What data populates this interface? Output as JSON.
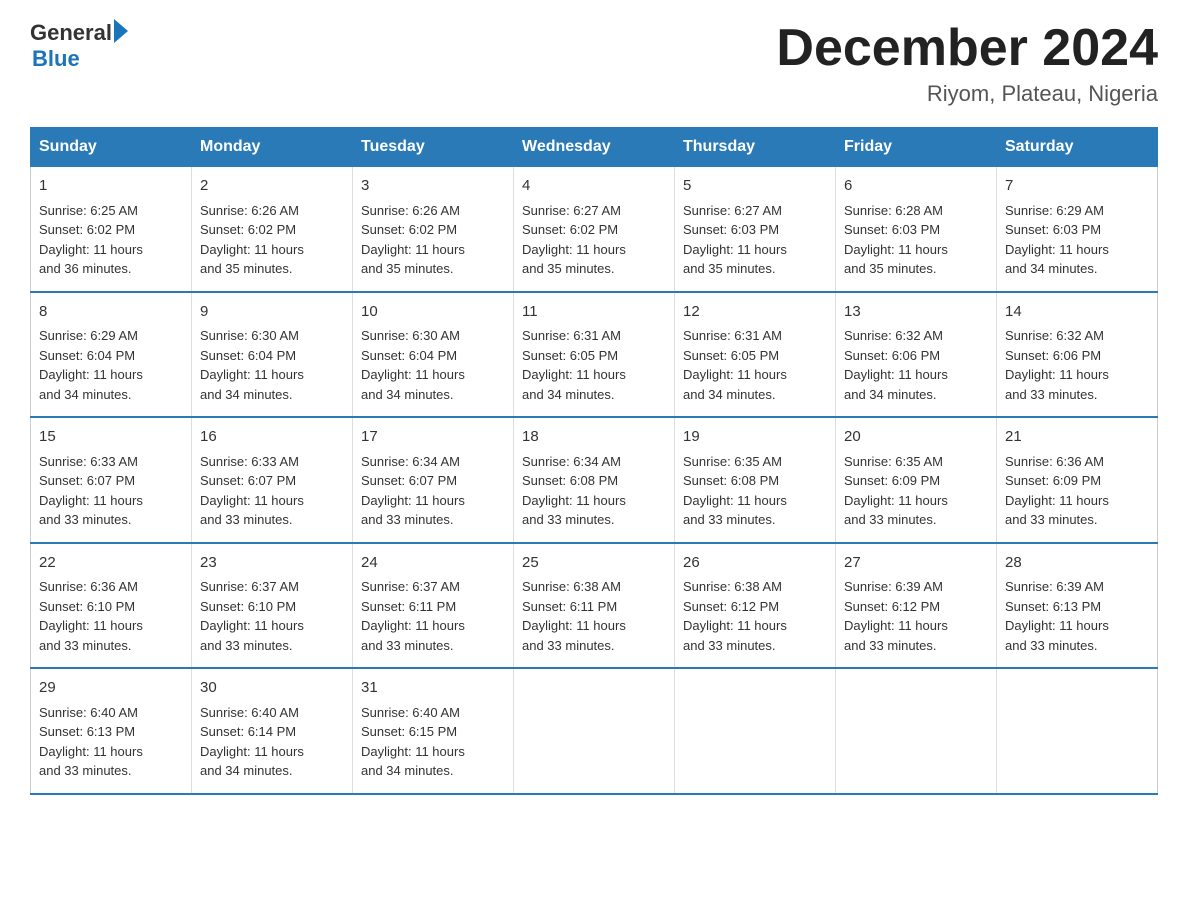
{
  "header": {
    "logo_general": "General",
    "logo_blue": "Blue",
    "month_title": "December 2024",
    "location": "Riyom, Plateau, Nigeria"
  },
  "days_of_week": [
    "Sunday",
    "Monday",
    "Tuesday",
    "Wednesday",
    "Thursday",
    "Friday",
    "Saturday"
  ],
  "weeks": [
    [
      {
        "day": "1",
        "sunrise": "6:25 AM",
        "sunset": "6:02 PM",
        "daylight": "11 hours and 36 minutes."
      },
      {
        "day": "2",
        "sunrise": "6:26 AM",
        "sunset": "6:02 PM",
        "daylight": "11 hours and 35 minutes."
      },
      {
        "day": "3",
        "sunrise": "6:26 AM",
        "sunset": "6:02 PM",
        "daylight": "11 hours and 35 minutes."
      },
      {
        "day": "4",
        "sunrise": "6:27 AM",
        "sunset": "6:02 PM",
        "daylight": "11 hours and 35 minutes."
      },
      {
        "day": "5",
        "sunrise": "6:27 AM",
        "sunset": "6:03 PM",
        "daylight": "11 hours and 35 minutes."
      },
      {
        "day": "6",
        "sunrise": "6:28 AM",
        "sunset": "6:03 PM",
        "daylight": "11 hours and 35 minutes."
      },
      {
        "day": "7",
        "sunrise": "6:29 AM",
        "sunset": "6:03 PM",
        "daylight": "11 hours and 34 minutes."
      }
    ],
    [
      {
        "day": "8",
        "sunrise": "6:29 AM",
        "sunset": "6:04 PM",
        "daylight": "11 hours and 34 minutes."
      },
      {
        "day": "9",
        "sunrise": "6:30 AM",
        "sunset": "6:04 PM",
        "daylight": "11 hours and 34 minutes."
      },
      {
        "day": "10",
        "sunrise": "6:30 AM",
        "sunset": "6:04 PM",
        "daylight": "11 hours and 34 minutes."
      },
      {
        "day": "11",
        "sunrise": "6:31 AM",
        "sunset": "6:05 PM",
        "daylight": "11 hours and 34 minutes."
      },
      {
        "day": "12",
        "sunrise": "6:31 AM",
        "sunset": "6:05 PM",
        "daylight": "11 hours and 34 minutes."
      },
      {
        "day": "13",
        "sunrise": "6:32 AM",
        "sunset": "6:06 PM",
        "daylight": "11 hours and 34 minutes."
      },
      {
        "day": "14",
        "sunrise": "6:32 AM",
        "sunset": "6:06 PM",
        "daylight": "11 hours and 33 minutes."
      }
    ],
    [
      {
        "day": "15",
        "sunrise": "6:33 AM",
        "sunset": "6:07 PM",
        "daylight": "11 hours and 33 minutes."
      },
      {
        "day": "16",
        "sunrise": "6:33 AM",
        "sunset": "6:07 PM",
        "daylight": "11 hours and 33 minutes."
      },
      {
        "day": "17",
        "sunrise": "6:34 AM",
        "sunset": "6:07 PM",
        "daylight": "11 hours and 33 minutes."
      },
      {
        "day": "18",
        "sunrise": "6:34 AM",
        "sunset": "6:08 PM",
        "daylight": "11 hours and 33 minutes."
      },
      {
        "day": "19",
        "sunrise": "6:35 AM",
        "sunset": "6:08 PM",
        "daylight": "11 hours and 33 minutes."
      },
      {
        "day": "20",
        "sunrise": "6:35 AM",
        "sunset": "6:09 PM",
        "daylight": "11 hours and 33 minutes."
      },
      {
        "day": "21",
        "sunrise": "6:36 AM",
        "sunset": "6:09 PM",
        "daylight": "11 hours and 33 minutes."
      }
    ],
    [
      {
        "day": "22",
        "sunrise": "6:36 AM",
        "sunset": "6:10 PM",
        "daylight": "11 hours and 33 minutes."
      },
      {
        "day": "23",
        "sunrise": "6:37 AM",
        "sunset": "6:10 PM",
        "daylight": "11 hours and 33 minutes."
      },
      {
        "day": "24",
        "sunrise": "6:37 AM",
        "sunset": "6:11 PM",
        "daylight": "11 hours and 33 minutes."
      },
      {
        "day": "25",
        "sunrise": "6:38 AM",
        "sunset": "6:11 PM",
        "daylight": "11 hours and 33 minutes."
      },
      {
        "day": "26",
        "sunrise": "6:38 AM",
        "sunset": "6:12 PM",
        "daylight": "11 hours and 33 minutes."
      },
      {
        "day": "27",
        "sunrise": "6:39 AM",
        "sunset": "6:12 PM",
        "daylight": "11 hours and 33 minutes."
      },
      {
        "day": "28",
        "sunrise": "6:39 AM",
        "sunset": "6:13 PM",
        "daylight": "11 hours and 33 minutes."
      }
    ],
    [
      {
        "day": "29",
        "sunrise": "6:40 AM",
        "sunset": "6:13 PM",
        "daylight": "11 hours and 33 minutes."
      },
      {
        "day": "30",
        "sunrise": "6:40 AM",
        "sunset": "6:14 PM",
        "daylight": "11 hours and 34 minutes."
      },
      {
        "day": "31",
        "sunrise": "6:40 AM",
        "sunset": "6:15 PM",
        "daylight": "11 hours and 34 minutes."
      },
      null,
      null,
      null,
      null
    ]
  ],
  "labels": {
    "sunrise": "Sunrise:",
    "sunset": "Sunset:",
    "daylight": "Daylight:"
  }
}
